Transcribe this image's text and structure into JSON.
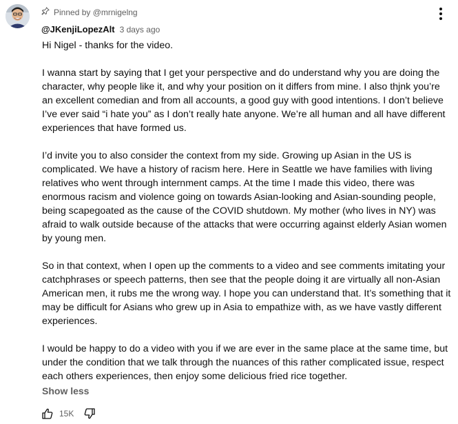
{
  "pinned": {
    "text": "Pinned by @mrnigelng",
    "icon": "pin-icon"
  },
  "author": {
    "name": "@JKenjiLopezAlt",
    "time": "3 days ago"
  },
  "paragraphs": [
    "Hi Nigel - thanks for the video.",
    "I wanna start by saying that I get your perspective and do understand why you are doing the character, why people like it, and why your position on it differs from mine. I also thjnk you’re an excellent comedian and from all accounts, a good guy with good intentions. I don’t believe I’ve ever said “i hate you” as I don’t really hate anyone. We’re all human and all have different experiences that have formed us.",
    "I’d invite you to also consider the context from my side. Growing up Asian in the US is complicated. We have a history of racism here. Here in Seattle we have families with living relatives who went through internment camps. At the time I made this video, there was enormous racism and violence going on towards Asian-looking and Asian-sounding people, being scapegoated as the cause of the COVID shutdown. My mother (who lives in NY) was afraid to walk outside because of the attacks that were occurring against elderly Asian women by young men.",
    "So in that context, when I open up the comments to a video and see comments imitating your catchphrases or speech patterns, then see that the people doing it are virtually all non-Asian American men, it rubs me the wrong way. I hope you can understand that. It’s something that it may be difficult for Asians who grew up in Asia to empathize with, as we have vastly different experiences.",
    "I would be happy to do a video with you if we are ever in the same place at the same time, but under the condition that we talk through the nuances of this rather complicated issue, respect each others experiences, then enjoy some delicious fried rice together."
  ],
  "show_less": "Show less",
  "likes": {
    "count": "15K"
  },
  "icons": {
    "more": "more-vert-icon",
    "like": "thumbs-up-icon",
    "dislike": "thumbs-down-icon"
  }
}
